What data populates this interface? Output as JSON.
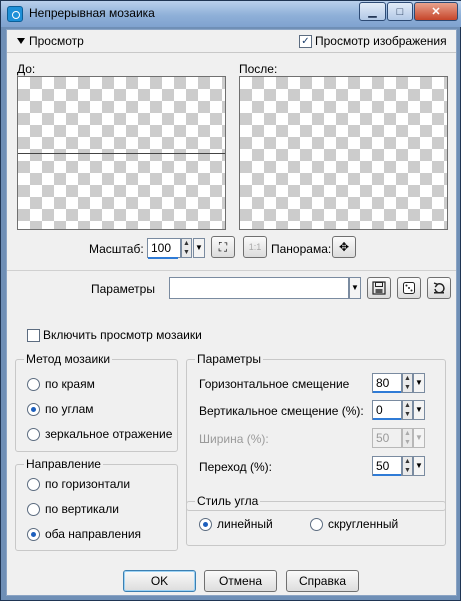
{
  "window": {
    "title": "Непрерывная мозаика",
    "minimize_glyph": "▁",
    "maximize_glyph": "□",
    "close_glyph": "✕"
  },
  "preview": {
    "section_label": "Просмотр",
    "show_preview_label": "Просмотр изображения",
    "show_preview_checked": true,
    "before_label": "До:",
    "after_label": "После:"
  },
  "zoom": {
    "label": "Масштаб:",
    "value": "100",
    "pan_label": "Панорама:"
  },
  "presets": {
    "label": "Параметры",
    "value": ""
  },
  "tile_preview": {
    "label": "Включить просмотр мозаики",
    "checked": false
  },
  "method": {
    "title": "Метод мозаики",
    "options": [
      "по краям",
      "по углам",
      "зеркальное отражение"
    ],
    "selected": "по углам"
  },
  "direction": {
    "title": "Направление",
    "options": [
      "по горизонтали",
      "по вертикали",
      "оба направления"
    ],
    "selected": "оба направления"
  },
  "params": {
    "title": "Параметры",
    "horizontal_offset_label": "Горизонтальное смещение",
    "horizontal_offset_value": "80",
    "vertical_offset_label": "Вертикальное смещение (%):",
    "vertical_offset_value": "0",
    "width_label": "Ширина (%):",
    "width_value": "50",
    "transition_label": "Переход (%):",
    "transition_value": "50"
  },
  "corner_style": {
    "title": "Стиль угла",
    "options": [
      "линейный",
      "скругленный"
    ],
    "selected": "линейный"
  },
  "buttons": {
    "ok": "OK",
    "cancel": "Отмена",
    "help": "Справка"
  },
  "icons": {
    "app": "app-icon",
    "zoom_fit": "zoom-fit-icon",
    "zoom_actual": "zoom-actual-icon",
    "pan": "pan-crosshair-icon",
    "save_preset": "save-icon",
    "random": "dice-icon",
    "reset": "reset-icon"
  },
  "colors": {
    "accent": "#2f7bd6",
    "titlebar": "#8fb0d8",
    "dialog_bg": "#f0f0f0"
  }
}
